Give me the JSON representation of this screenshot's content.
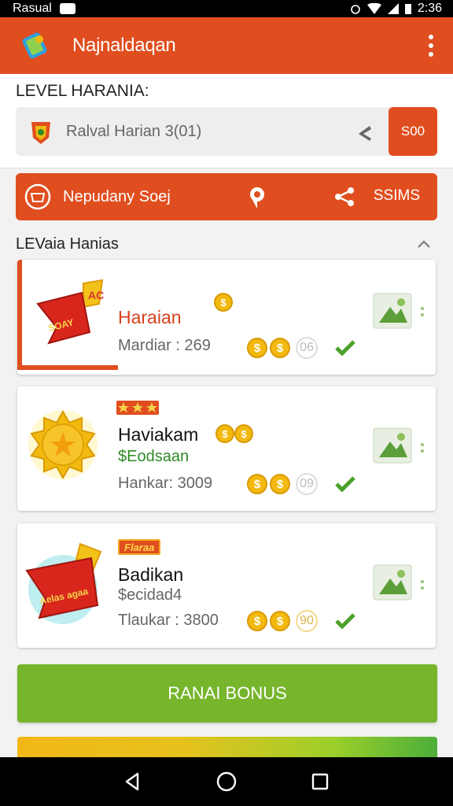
{
  "status_bar": {
    "carrier": "Rasual",
    "time": "2:36"
  },
  "app_bar": {
    "title": "Najnaldaqan",
    "icons": [
      "app-logo-icon",
      "more-vert-icon"
    ]
  },
  "level_panel": {
    "heading": "LEVEL HARANIA:",
    "search_text": "Ralval Harian 3(01)",
    "search_button": "S00"
  },
  "action_bar": {
    "label": "Nepudany Soej",
    "right_label": "SSIMS"
  },
  "section": {
    "title": "LEVaia Hanias"
  },
  "cards": [
    {
      "art_text": "SOAY",
      "badge": "AC",
      "title": "Haraian",
      "meta": "Mardiar : 269",
      "coin_count": "06"
    },
    {
      "title": "Haviakam",
      "subtitle": "$Eodsaan",
      "meta": "Hankar: 3009",
      "coin_count": "09"
    },
    {
      "tag": "Flaraa",
      "art_text": "Aelas agaa",
      "title": "Badikan",
      "subtitle": "$ecidad4",
      "meta": "Tlaukar : 3800",
      "coin_count": "90"
    }
  ],
  "bonus_button": {
    "label": "RANAI BONUS"
  },
  "colors": {
    "primary": "#e04e1f",
    "success": "#76b52c",
    "coin": "#f2b90f"
  }
}
